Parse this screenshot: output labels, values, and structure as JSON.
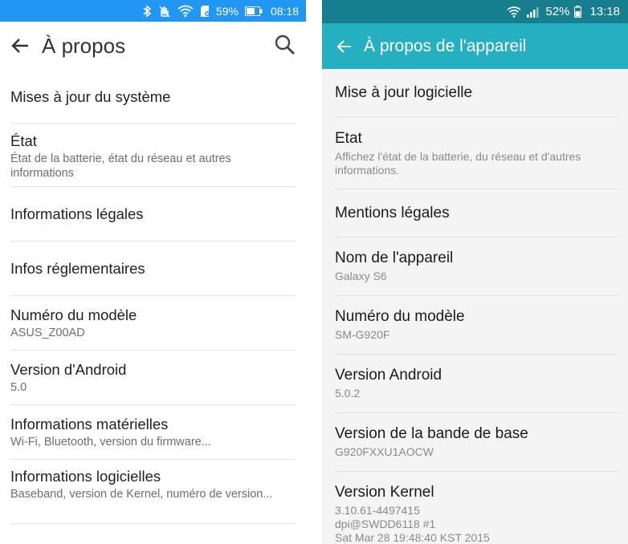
{
  "left": {
    "status": {
      "battery": "59%",
      "time": "08:18"
    },
    "appbar": {
      "title": "À propos"
    },
    "items": [
      {
        "title": "Mises à jour du système",
        "subtitle": ""
      },
      {
        "title": "État",
        "subtitle": "État de la batterie, état du réseau et autres informations"
      },
      {
        "title": "Informations légales",
        "subtitle": ""
      },
      {
        "title": "Infos réglementaires",
        "subtitle": ""
      },
      {
        "title": "Numéro du modèle",
        "subtitle": "ASUS_Z00AD"
      },
      {
        "title": "Version d'Android",
        "subtitle": "5.0"
      },
      {
        "title": "Informations matérielles",
        "subtitle": "Wi-Fi, Bluetooth, version du firmware..."
      },
      {
        "title": "Informations logicielles",
        "subtitle": "Baseband, version de Kernel, numéro de version..."
      }
    ]
  },
  "right": {
    "status": {
      "battery": "52%",
      "time": "13:18"
    },
    "appbar": {
      "title": "À propos de l'appareil"
    },
    "items": [
      {
        "title": "Mise à jour logicielle",
        "subtitle": ""
      },
      {
        "title": "Etat",
        "subtitle": "Affichez l'état de la batterie, du réseau et d'autres informations."
      },
      {
        "title": "Mentions légales",
        "subtitle": ""
      },
      {
        "title": "Nom de l'appareil",
        "subtitle": "Galaxy S6"
      },
      {
        "title": "Numéro du modèle",
        "subtitle": "SM-G920F"
      },
      {
        "title": "Version Android",
        "subtitle": "5.0.2"
      },
      {
        "title": "Version de la bande de base",
        "subtitle": "G920FXXU1AOCW"
      },
      {
        "title": "Version Kernel",
        "subtitle": "3.10.61-4497415",
        "subtitle2": "dpi@SWDD6118 #1",
        "subtitle3": "Sat Mar 28 19:48:40 KST 2015"
      }
    ]
  },
  "colors": {
    "left_status_bg": "#2196f3",
    "right_status_bg": "#167e8e",
    "right_appbar_bg": "#26aec1"
  },
  "icons": [
    "bluetooth-icon",
    "hand-icon",
    "wifi-icon",
    "sd-card-icon",
    "battery-icon",
    "back-arrow-icon",
    "search-icon",
    "signal-icon"
  ]
}
